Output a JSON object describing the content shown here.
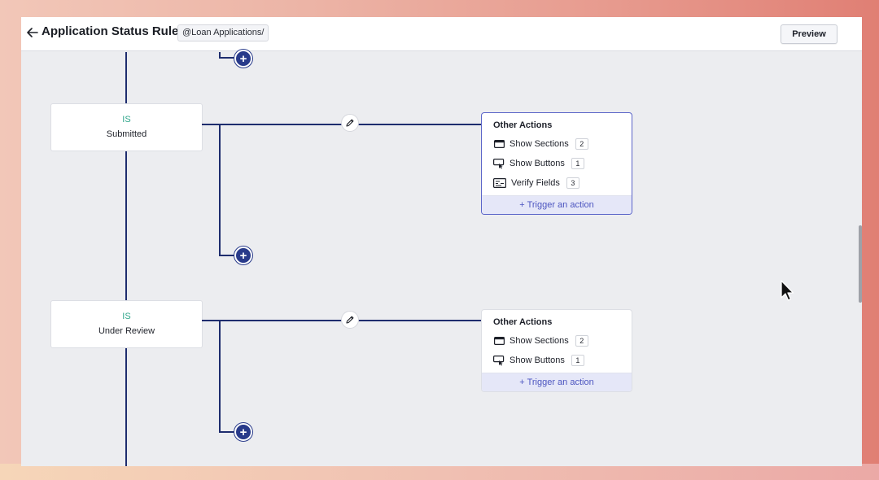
{
  "header": {
    "title": "Application Status Rule",
    "form_chip": "@Loan Applications/",
    "preview_label": "Preview"
  },
  "conditions": [
    {
      "operator": "IS",
      "value": "Submitted",
      "actions": {
        "title": "Other Actions",
        "items": [
          {
            "icon": "section-icon",
            "label": "Show Sections",
            "count": "2"
          },
          {
            "icon": "button-icon",
            "label": "Show Buttons",
            "count": "1"
          },
          {
            "icon": "verify-fields-icon",
            "label": "Verify Fields",
            "count": "3"
          }
        ],
        "trigger_label": "+ Trigger an action"
      }
    },
    {
      "operator": "IS",
      "value": "Under Review",
      "actions": {
        "title": "Other Actions",
        "items": [
          {
            "icon": "section-icon",
            "label": "Show Sections",
            "count": "2"
          },
          {
            "icon": "button-icon",
            "label": "Show Buttons",
            "count": "1"
          }
        ],
        "trigger_label": "+ Trigger an action"
      }
    }
  ],
  "colors": {
    "connector": "#1e2d6e",
    "plus_button": "#283a8a",
    "operator_text": "#2ea58a",
    "trigger_bg": "#e5e7f8",
    "trigger_text": "#4c55c0",
    "selected_border": "#5a64c8"
  }
}
